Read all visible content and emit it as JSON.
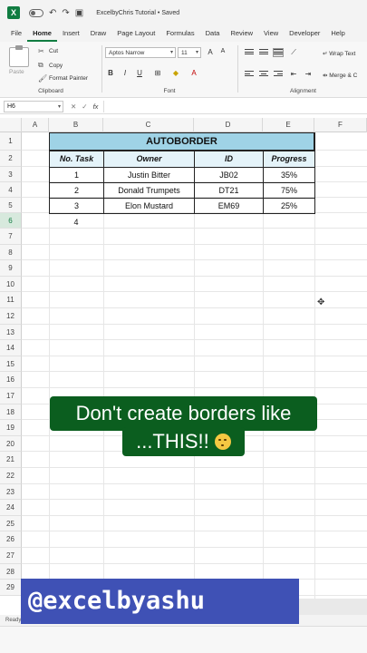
{
  "app": {
    "title": "ExcelbyChris Tutorial • Saved",
    "logo_letter": "X",
    "quick_access": [
      "autosave-toggle",
      "undo-icon",
      "redo-icon",
      "save-icon"
    ]
  },
  "menu": {
    "tabs": [
      "File",
      "Home",
      "Insert",
      "Draw",
      "Page Layout",
      "Formulas",
      "Data",
      "Review",
      "View",
      "Developer",
      "Help"
    ],
    "active": "Home"
  },
  "ribbon": {
    "clipboard": {
      "paste": "Paste",
      "cut": "Cut",
      "copy": "Copy",
      "format_painter": "Format Painter",
      "group_label": "Clipboard"
    },
    "font": {
      "font_name": "Aptos Narrow",
      "font_size": "11",
      "bold": "B",
      "italic": "I",
      "underline": "U",
      "group_label": "Font"
    },
    "alignment": {
      "wrap_text": "Wrap Text",
      "merge_center": "Merge & C",
      "group_label": "Alignment"
    }
  },
  "formula_bar": {
    "name_box": "H6",
    "fx": "fx",
    "content": ""
  },
  "grid": {
    "columns": [
      "A",
      "B",
      "C",
      "D",
      "E",
      "F"
    ],
    "selected_column": "H",
    "rows": [
      "1",
      "2",
      "3",
      "4",
      "5",
      "6",
      "7",
      "8",
      "9",
      "10",
      "11",
      "12",
      "13",
      "14",
      "15",
      "16",
      "17",
      "18",
      "19",
      "20",
      "21",
      "22",
      "23",
      "24",
      "25",
      "26",
      "27",
      "28",
      "29"
    ],
    "selected_row": "6"
  },
  "table": {
    "title": "AUTOBORDER",
    "headers": [
      "No. Task",
      "Owner",
      "ID",
      "Progress"
    ],
    "rows": [
      [
        "1",
        "Justin Bitter",
        "JB02",
        "35%"
      ],
      [
        "2",
        "Donald Trumpets",
        "DT21",
        "75%"
      ],
      [
        "3",
        "Elon Mustard",
        "EM69",
        "25%"
      ]
    ],
    "extra_task": "4"
  },
  "overlay": {
    "caption_line1": "Don't create borders like",
    "caption_line2": "...THIS!!",
    "emoji_name": "woozy-face",
    "handle": "@excelbyashu"
  },
  "status": {
    "text": "Ready"
  },
  "colors": {
    "brand_green": "#107c41",
    "title_fill": "#9fd3e6",
    "header_fill": "#e4f3f9",
    "caption_bg": "#0b5e1f",
    "handle_bg": "#3f51b5"
  }
}
